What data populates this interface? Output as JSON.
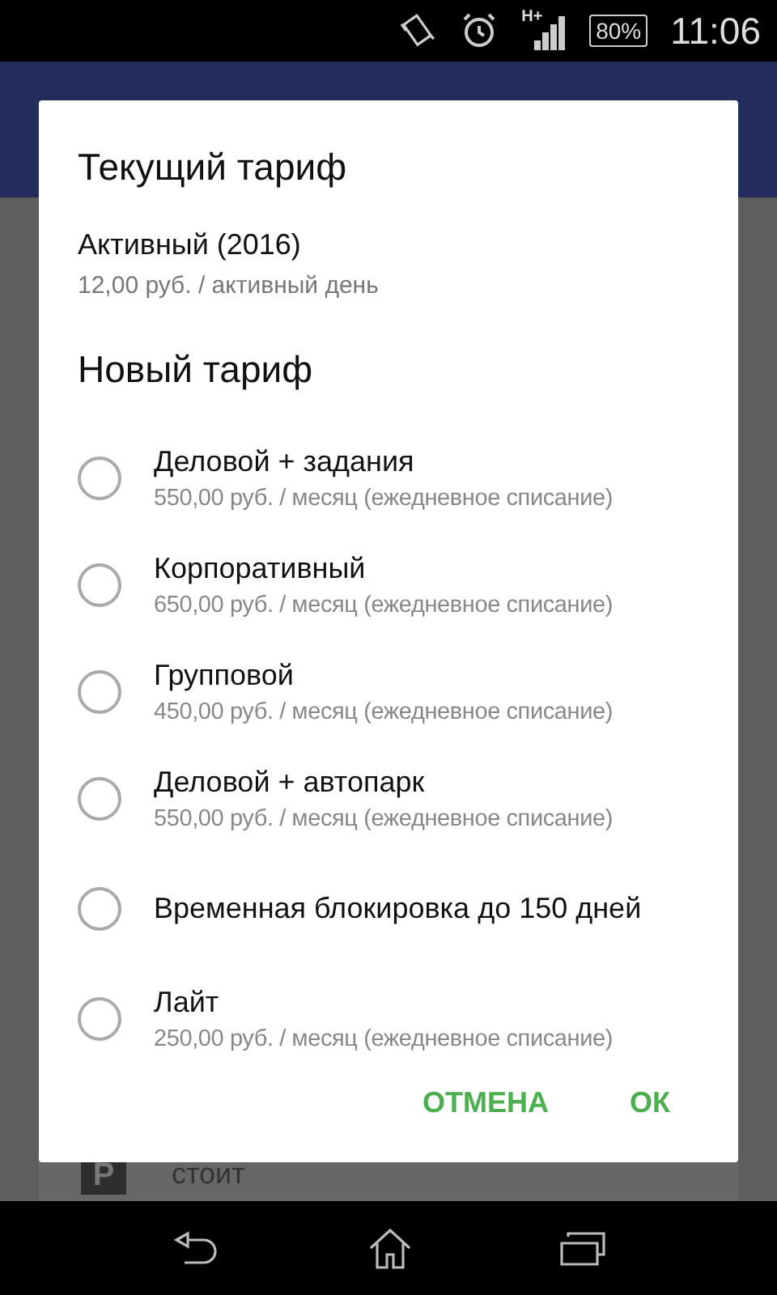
{
  "status_bar": {
    "network": "H+",
    "battery": "80%",
    "time": "11:06"
  },
  "background_card": {
    "icon_letter": "P",
    "label": "стоит"
  },
  "dialog": {
    "current_title": "Текущий тариф",
    "current_name": "Активный (2016)",
    "current_price": "12,00 руб. / активный день",
    "new_title": "Новый тариф",
    "options": [
      {
        "name": "Деловой + задания",
        "price": "550,00 руб. / месяц (ежедневное списание)",
        "selected": false
      },
      {
        "name": "Корпоративный",
        "price": "650,00 руб. / месяц (ежедневное списание)",
        "selected": false
      },
      {
        "name": "Групповой",
        "price": "450,00 руб. / месяц (ежедневное списание)",
        "selected": false
      },
      {
        "name": "Деловой + автопарк",
        "price": "550,00 руб. / месяц (ежедневное списание)",
        "selected": false
      },
      {
        "name": "Временная блокировка до 150 дней",
        "selected": false
      },
      {
        "name": "Лайт",
        "price": "250,00 руб. / месяц (ежедневное списание)",
        "selected": false
      }
    ],
    "buttons": [
      "ОТМЕНА",
      "ОК"
    ]
  }
}
